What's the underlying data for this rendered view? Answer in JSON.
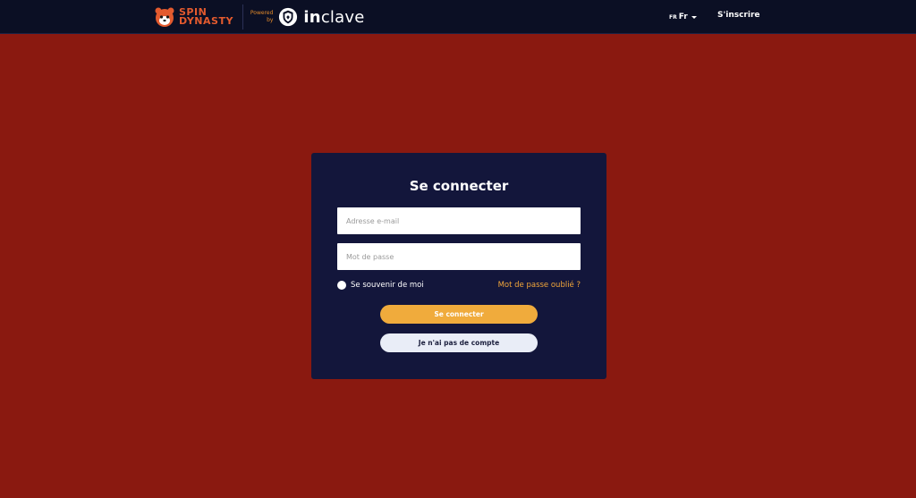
{
  "header": {
    "brand_line1": "SPIN",
    "brand_line2": "DYNASTY",
    "powered_line1": "Powered",
    "powered_line2": "by",
    "partner_bold": "in",
    "partner_rest": "clave",
    "lang_code": "FR",
    "lang_label": "Fr",
    "signup_label": "S'inscrire"
  },
  "login": {
    "title": "Se connecter",
    "email_placeholder": "Adresse e-mail",
    "password_placeholder": "Mot de passe",
    "remember_label": "Se souvenir de moi",
    "forgot_label": "Mot de passe oublié ?",
    "submit_label": "Se connecter",
    "no_account_label": "Je n'ai pas de compte"
  },
  "icons": {
    "brand": "red-panda-logo-icon",
    "partner": "shield-logo-icon",
    "lang_caret": "caret-down-icon"
  },
  "colors": {
    "background": "#8a1910",
    "header": "#0b0f24",
    "card": "#13163b",
    "accent": "#f0ab3c",
    "link": "#f2a63a",
    "brand": "#e35a2e"
  }
}
